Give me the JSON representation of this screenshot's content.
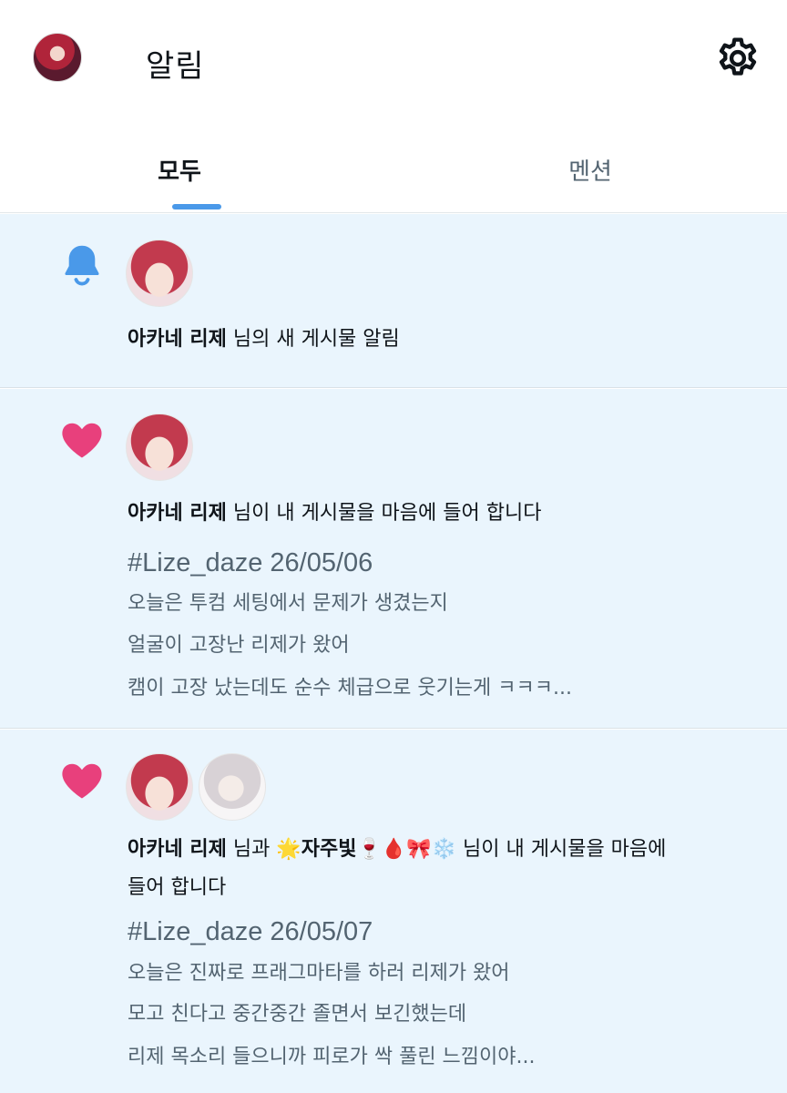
{
  "header": {
    "title": "알림",
    "avatar_icon": "profile-avatar",
    "settings_icon": "gear-icon"
  },
  "tabs": [
    {
      "label": "모두",
      "active": true
    },
    {
      "label": "멘션",
      "active": false
    }
  ],
  "colors": {
    "accent": "#4a99e9",
    "heart": "#e8407c",
    "bell": "#4a99e9",
    "unread_bg": "#eaf5fd"
  },
  "notifications": [
    {
      "icon": "bell-icon",
      "user": "아카네 리제",
      "action": " 님의 새 게시물 알림"
    },
    {
      "icon": "heart-icon",
      "user": "아카네 리제",
      "action": " 님이 내 게시물을 마음에 들어 합니다",
      "hashtag": "#Lize_daze 26/05/06",
      "lines": [
        "오늘은 투컴 세팅에서 문제가 생겼는지",
        "얼굴이 고장난 리제가 왔어",
        "캠이 고장 났는데도 순수 체급으로 웃기는게 ㅋㅋㅋ..."
      ]
    },
    {
      "icon": "heart-icon",
      "user": "아카네 리제",
      "connector": " 님과 ",
      "user2": "🌟자주빛🍷🩸🎀❄️",
      "action": " 님이 내 게시물을 마음에",
      "action_cont": "들어 합니다",
      "hashtag": "#Lize_daze 26/05/07",
      "lines": [
        "오늘은 진짜로 프래그마타를 하러 리제가 왔어",
        "모고 친다고 중간중간 졸면서 보긴했는데",
        "리제 목소리 들으니까 피로가 싹 풀린 느낌이야..."
      ]
    }
  ]
}
